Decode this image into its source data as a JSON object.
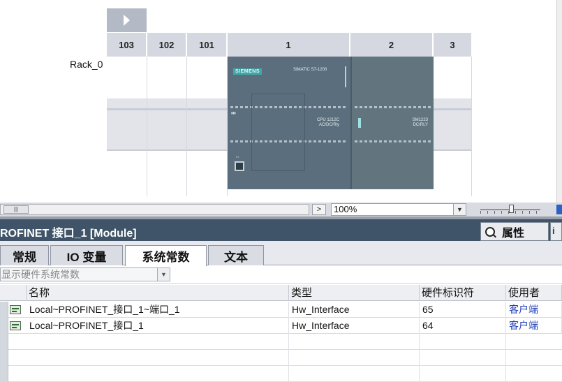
{
  "device_view": {
    "rack_label": "Rack_0",
    "slots": [
      "103",
      "102",
      "101",
      "1",
      "2",
      "3"
    ],
    "cpu": {
      "brand": "SIEMENS",
      "series": "SIMATIC S7-1200",
      "model_line1": "CPU 1212C",
      "model_line2": "AC/DC/Rly"
    },
    "sm": {
      "model_line1": "SM1223",
      "model_line2": "DC/RLY"
    }
  },
  "toolbar": {
    "zoom_value": "100%"
  },
  "inspector": {
    "title": "ROFINET 接口_1 [Module]",
    "properties_tab": "属性",
    "tabs": [
      "常规",
      "IO 变量",
      "系统常数",
      "文本"
    ],
    "active_tab_index": 2,
    "filter_placeholder": "显示硬件系统常数",
    "table": {
      "headers": [
        "名称",
        "类型",
        "硬件标识符",
        "使用者"
      ],
      "rows": [
        {
          "name": "Local~PROFINET_接口_1~端口_1",
          "type": "Hw_Interface",
          "hw_id": "65",
          "user": "客户端"
        },
        {
          "name": "Local~PROFINET_接口_1",
          "type": "Hw_Interface",
          "hw_id": "64",
          "user": "客户端"
        }
      ]
    }
  },
  "colors": {
    "title_bar": "#3f5468",
    "module_body": "#5b6e7d",
    "slot_header": "#d5d8e0",
    "link": "#1f3fb5"
  }
}
